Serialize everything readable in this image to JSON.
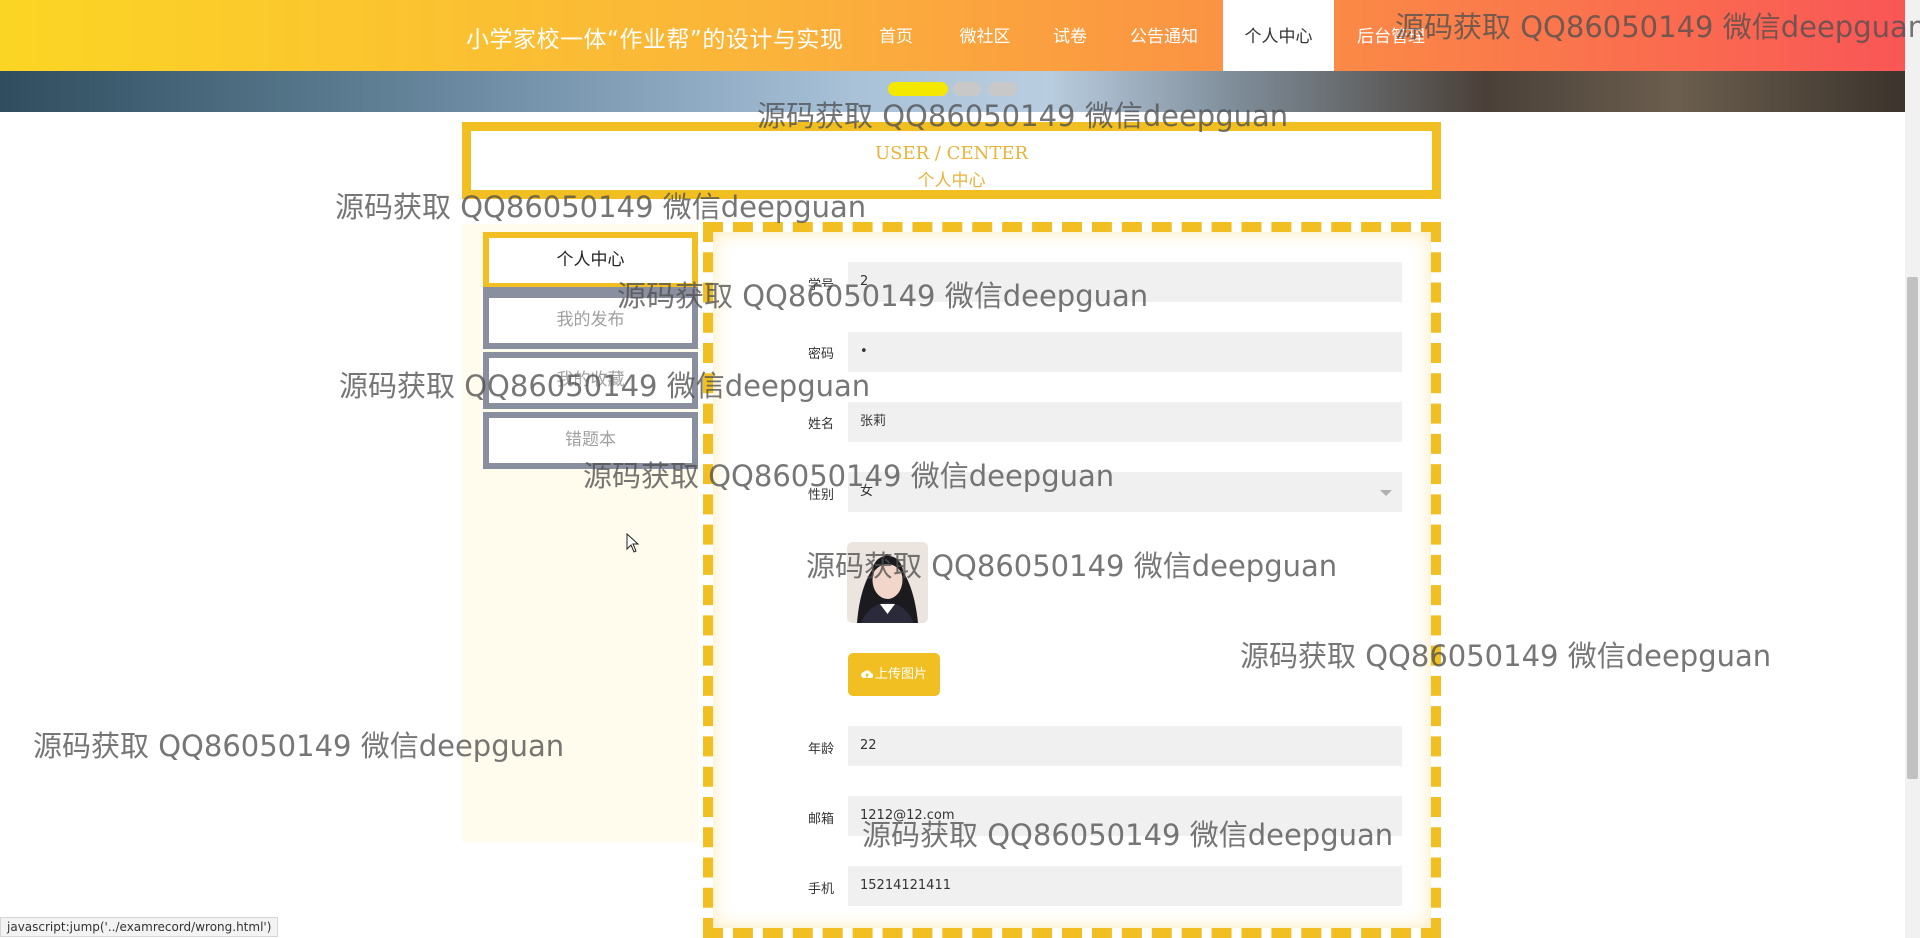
{
  "header": {
    "site_title": "小学家校一体“作业帮”的设计与实现",
    "nav": [
      {
        "label": "首页"
      },
      {
        "label": "微社区"
      },
      {
        "label": "试卷"
      },
      {
        "label": "公告通知"
      },
      {
        "label": "个人中心",
        "active": true
      },
      {
        "label": "后台管理"
      }
    ]
  },
  "carousel": {
    "dots": 3,
    "active_index": 0
  },
  "heading": {
    "en": "USER / CENTER",
    "cn": "个人中心"
  },
  "sidebar": {
    "items": [
      {
        "label": "个人中心",
        "active": true
      },
      {
        "label": "我的发布"
      },
      {
        "label": "我的收藏"
      },
      {
        "label": "错题本"
      }
    ]
  },
  "form": {
    "fields": [
      {
        "label": "学号",
        "value": "2"
      },
      {
        "label": "密码",
        "value": "•"
      },
      {
        "label": "姓名",
        "value": "张莉"
      },
      {
        "label": "性别",
        "value": "女"
      },
      {
        "label": "年龄",
        "value": "22"
      },
      {
        "label": "邮箱",
        "value": "1212@12.com"
      },
      {
        "label": "手机",
        "value": "15214121411"
      }
    ],
    "upload_label": "上传图片"
  },
  "statusbar": {
    "text": "javascript:jump('../examrecord/wrong.html')"
  },
  "watermark": "源码获取 QQ86050149 微信deepguan",
  "colors": {
    "accent": "#f1bf22",
    "nav_start": "#fbd524",
    "nav_end": "#f95656"
  },
  "icons": {
    "upload": "cloud-upload-icon",
    "select": "chevron-down-icon"
  }
}
